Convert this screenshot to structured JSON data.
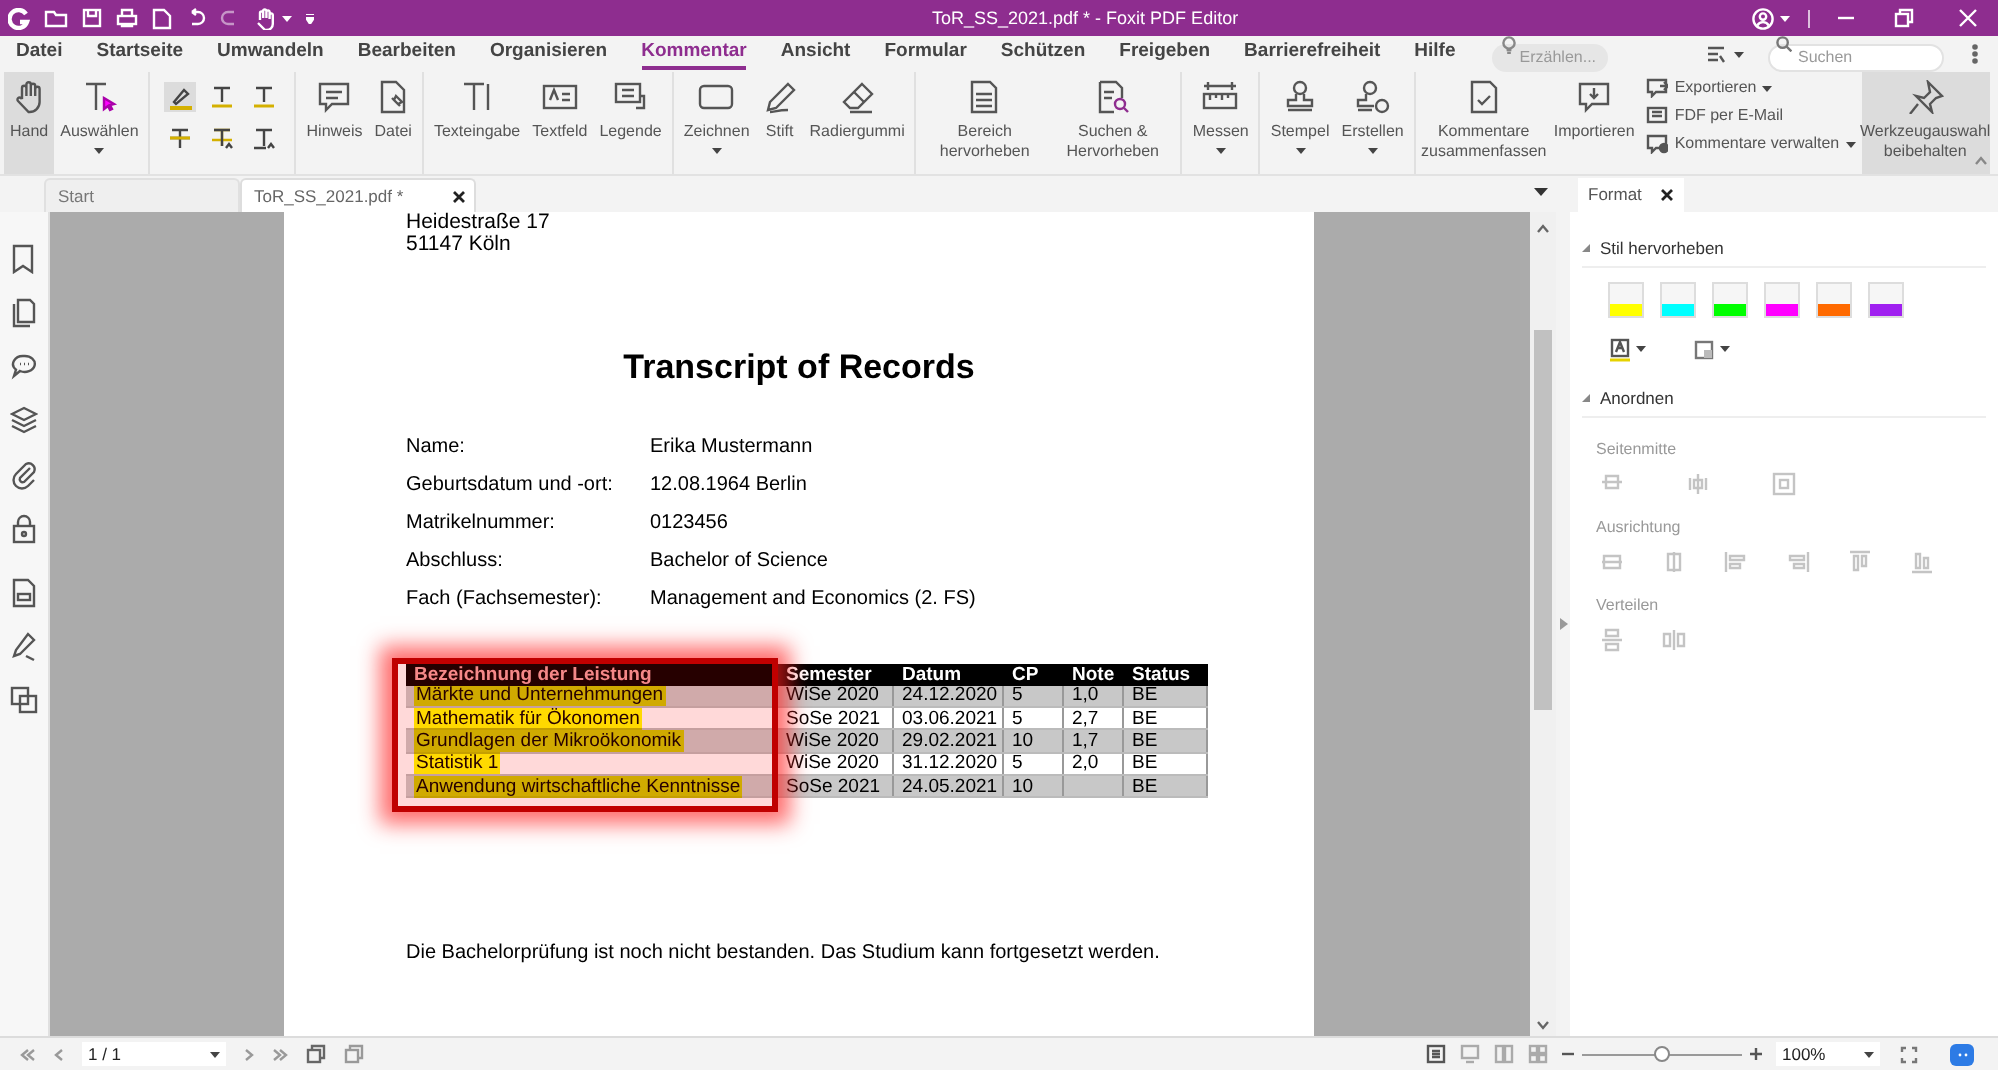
{
  "window": {
    "title": "ToR_SS_2021.pdf * - Foxit PDF Editor"
  },
  "menu": [
    {
      "label": "Datei",
      "selected": false
    },
    {
      "label": "Startseite",
      "selected": false
    },
    {
      "label": "Umwandeln",
      "selected": false
    },
    {
      "label": "Bearbeiten",
      "selected": false
    },
    {
      "label": "Organisieren",
      "selected": false
    },
    {
      "label": "Kommentar",
      "selected": true
    },
    {
      "label": "Ansicht",
      "selected": false
    },
    {
      "label": "Formular",
      "selected": false
    },
    {
      "label": "Schützen",
      "selected": false
    },
    {
      "label": "Freigeben",
      "selected": false
    },
    {
      "label": "Barrierefreiheit",
      "selected": false
    },
    {
      "label": "Hilfe",
      "selected": false
    }
  ],
  "tell_me": {
    "placeholder": "Erzählen..."
  },
  "search": {
    "placeholder": "Suchen"
  },
  "ribbon": [
    {
      "tools": [
        {
          "kind": "large",
          "label": "Hand",
          "selected": true
        },
        {
          "kind": "large",
          "label": "Auswählen",
          "dropdown": true,
          "selected": false
        }
      ]
    },
    {
      "tools": [
        {
          "kind": "mini",
          "selected": true
        },
        {
          "kind": "mini",
          "selected": false
        },
        {
          "kind": "mini",
          "selected": false
        },
        {
          "kind": "mini",
          "selected": false
        },
        {
          "kind": "mini",
          "selected": false
        },
        {
          "kind": "mini",
          "selected": false
        }
      ]
    },
    {
      "tools": [
        {
          "kind": "large",
          "label": "Hinweis",
          "selected": false
        },
        {
          "kind": "large",
          "label": "Datei",
          "selected": false
        }
      ]
    },
    {
      "tools": [
        {
          "kind": "large",
          "label": "Texteingabe",
          "selected": false
        },
        {
          "kind": "large",
          "label": "Textfeld",
          "selected": false
        },
        {
          "kind": "large",
          "label": "Legende",
          "selected": false
        }
      ]
    },
    {
      "tools": [
        {
          "kind": "large",
          "label": "Zeichnen",
          "dropdown": true,
          "selected": false
        },
        {
          "kind": "large",
          "label": "Stift",
          "selected": false
        },
        {
          "kind": "large",
          "label": "Radiergummi",
          "selected": false
        }
      ]
    },
    {
      "tools": [
        {
          "kind": "large",
          "label": "Bereich hervorheben",
          "selected": false
        },
        {
          "kind": "large",
          "label": "Suchen & Hervorheben",
          "selected": false
        }
      ]
    },
    {
      "tools": [
        {
          "kind": "large",
          "label": "Messen",
          "dropdown": true,
          "selected": false
        }
      ]
    },
    {
      "tools": [
        {
          "kind": "large",
          "label": "Stempel",
          "dropdown": true,
          "selected": false
        },
        {
          "kind": "large",
          "label": "Erstellen",
          "dropdown": true,
          "selected": false
        }
      ]
    },
    {
      "tools": [
        {
          "kind": "large",
          "label": "Kommentare zusammenfassen",
          "selected": false
        },
        {
          "kind": "large",
          "label": "Importieren",
          "selected": false
        },
        {
          "kind": "small",
          "label": "Exportieren",
          "dropdown": true,
          "selected": false
        },
        {
          "kind": "small",
          "label": "FDF per E-Mail",
          "selected": false
        },
        {
          "kind": "small",
          "label": "Kommentare verwalten",
          "dropdown": true,
          "selected": false
        },
        {
          "kind": "large",
          "label": "Werkzeugauswahl beibehalten",
          "selected": true
        }
      ]
    }
  ],
  "tabs": [
    {
      "label": "Start",
      "selected": false
    },
    {
      "label": "ToR_SS_2021.pdf *",
      "selected": true
    }
  ],
  "document": {
    "address": [
      "Heidestraße 17",
      "51147 Köln"
    ],
    "title": "Transcript of Records",
    "fields": [
      {
        "label": "Name:",
        "value": "Erika Mustermann"
      },
      {
        "label": "Geburtsdatum und -ort:",
        "value": "12.08.1964 Berlin"
      },
      {
        "label": "Matrikelnummer:",
        "value": "0123456"
      },
      {
        "label": "Abschluss:",
        "value": "Bachelor of Science"
      },
      {
        "label": "Fach (Fachsemester):",
        "value": "Management and Economics (2. FS)"
      }
    ],
    "table": {
      "columns": [
        "Bezeichnung der Leistung",
        "Semester",
        "Datum",
        "CP",
        "Note",
        "Status"
      ],
      "rows": [
        {
          "cells": [
            "Märkte und Unternehmungen",
            "WiSe 2020",
            "24.12.2020",
            "5",
            "1,0",
            "BE"
          ],
          "highlighted": true
        },
        {
          "cells": [
            "Mathematik für Ökonomen",
            "SoSe 2021",
            "03.06.2021",
            "5",
            "2,7",
            "BE"
          ],
          "highlighted": true
        },
        {
          "cells": [
            "Grundlagen der Mikroökonomik",
            "WiSe 2020",
            "29.02.2021",
            "10",
            "1,7",
            "BE"
          ],
          "highlighted": true
        },
        {
          "cells": [
            "Statistik 1",
            "WiSe 2020",
            "31.12.2020",
            "5",
            "2,0",
            "BE"
          ],
          "highlighted": true
        },
        {
          "cells": [
            "Anwendung wirtschaftliche Kenntnisse",
            "SoSe 2021",
            "24.05.2021",
            "10",
            "",
            "BE"
          ],
          "highlighted": true
        }
      ]
    },
    "footer": "Die Bachelorprüfung ist noch nicht bestanden. Das Studium kann fortgesetzt werden."
  },
  "format_panel": {
    "tab": "Format",
    "sections": [
      {
        "kind": "swatches",
        "title": "Stil hervorheben",
        "expanded": true,
        "swatches": [
          {
            "color": "#ffff00"
          },
          {
            "color": "#00ffff"
          },
          {
            "color": "#00ff00"
          },
          {
            "color": "#ff00ff"
          },
          {
            "color": "#ff6a00"
          },
          {
            "color": "#a020f0"
          }
        ]
      },
      {
        "kind": "arrange",
        "title": "Anordnen",
        "expanded": true,
        "groups": [
          {
            "label": "Seitenmitte",
            "disabled": true
          },
          {
            "label": "Ausrichtung",
            "disabled": true
          },
          {
            "label": "Verteilen",
            "disabled": true
          }
        ]
      }
    ]
  },
  "status_bar": {
    "page": "1 / 1",
    "zoom": "100%",
    "zoom_slider": {
      "level": 0.5
    }
  }
}
